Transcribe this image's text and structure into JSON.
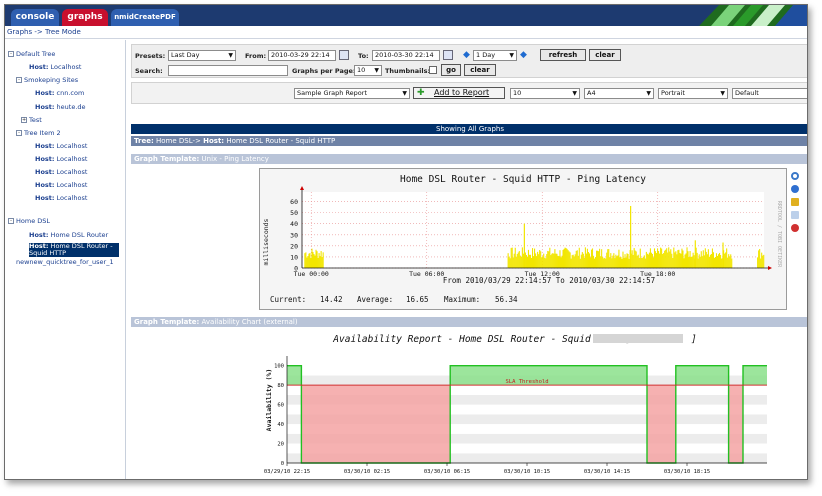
{
  "tabs": [
    {
      "label": "console",
      "color": "#2f5fb0"
    },
    {
      "label": "graphs",
      "color": "#c8102e"
    },
    {
      "label": "nmidCreatePDF",
      "color": "#2f5fb0"
    }
  ],
  "breadcrumb": "Graphs -> Tree Mode",
  "sidebar": {
    "items": [
      {
        "prefix": "",
        "label": "Default Tree",
        "box": "-"
      },
      {
        "prefix": "Host:",
        "label": " Localhost",
        "box": ""
      },
      {
        "prefix": "",
        "label": "Smokeping Sites",
        "box": "-"
      },
      {
        "prefix": "Host:",
        "label": " cnn.com",
        "box": ""
      },
      {
        "prefix": "Host:",
        "label": " heute.de",
        "box": ""
      },
      {
        "prefix": "",
        "label": "Test",
        "box": "+"
      },
      {
        "prefix": "",
        "label": "Tree Item 2",
        "box": "-"
      },
      {
        "prefix": "Host:",
        "label": " Localhost",
        "box": ""
      },
      {
        "prefix": "Host:",
        "label": " Localhost",
        "box": ""
      },
      {
        "prefix": "Host:",
        "label": " Localhost",
        "box": ""
      },
      {
        "prefix": "Host:",
        "label": " Localhost",
        "box": ""
      },
      {
        "prefix": "Host:",
        "label": " Localhost",
        "box": ""
      },
      {
        "prefix": "",
        "label": "Home DSL",
        "box": "-"
      },
      {
        "prefix": "Host:",
        "label": " Home DSL Router",
        "box": ""
      },
      {
        "prefix": "Host:",
        "label": " Home DSL Router - Squid HTTP",
        "box": ""
      },
      {
        "prefix": "",
        "label": "newnew_quicktree_for_user_1",
        "box": ""
      }
    ]
  },
  "filters": {
    "presets_label": "Presets:",
    "presets_value": "Last Day",
    "from_label": "From:",
    "from_value": "2010-03-29 22:14",
    "to_label": "To:",
    "to_value": "2010-03-30 22:14",
    "span_value": "1 Day",
    "refresh_label": "refresh",
    "clear_label": "clear",
    "search_label": "Search:",
    "search_value": "",
    "gpp_label": "Graphs per Page:",
    "gpp_value": "10",
    "thumbs_label": "Thumbnails:",
    "go_label": "go",
    "clear2_label": "clear"
  },
  "report": {
    "report_select": "Sample Graph Report",
    "add_label": "Add to Report",
    "count_select": "10",
    "paper_select": "A4",
    "orient_select": "Portrait",
    "style_select": "Default"
  },
  "showing": "Showing All Graphs",
  "tree_header": {
    "prefix": "Tree:",
    "path": " Home DSL-> ",
    "host_prefix": "Host:",
    "host": " Home DSL Router - Squid HTTP"
  },
  "template1": {
    "prefix": "Graph Template:",
    "name": " Unix - Ping Latency"
  },
  "template2": {
    "prefix": "Graph Template:",
    "name": " Availability Chart (external)"
  },
  "ping_graph": {
    "title": "Home DSL Router - Squid HTTP - Ping Latency",
    "ylabel": "milliseconds",
    "side_text": "RRDTOOL / TOBI OETIKER",
    "range_text": "From 2010/03/29 22:14:57 To 2010/03/30 22:14:57",
    "current_label": "Current:",
    "current_value": "14.42",
    "average_label": "Average:",
    "average_value": "16.65",
    "maximum_label": "Maximum:",
    "maximum_value": "56.34"
  },
  "avail_graph": {
    "title": "Availability Report - Home DSL Router - Squid HTTP [",
    "title_end": "]",
    "ylabel": "Availability (%)",
    "sla_label": "SLA Threshold"
  },
  "chart_data": [
    {
      "type": "bar",
      "title": "Home DSL Router - Squid HTTP - Ping Latency",
      "ylabel": "milliseconds",
      "x_ticks": [
        "Tue 00:00",
        "Tue 06:00",
        "Tue 12:00",
        "Tue 18:00"
      ],
      "y_ticks": [
        0,
        10,
        20,
        30,
        40,
        50,
        60
      ],
      "ylim": [
        0,
        65
      ],
      "color": "#f2e600",
      "spikes": [
        {
          "pos": 0.48,
          "value": 40
        },
        {
          "pos": 0.71,
          "value": 56
        },
        {
          "pos": 0.85,
          "value": 25
        },
        {
          "pos": 0.91,
          "value": 23
        }
      ],
      "segments": [
        {
          "start": 0.005,
          "end": 0.045,
          "base": 15
        },
        {
          "start": 0.445,
          "end": 0.93,
          "base": 15
        },
        {
          "start": 0.985,
          "end": 1.0,
          "base": 15
        }
      ],
      "current": 14.42,
      "average": 16.65,
      "maximum": 56.34
    },
    {
      "type": "area",
      "title": "Availability Report - Home DSL Router - Squid HTTP",
      "ylabel": "Availability (%)",
      "x_ticks": [
        "03/29/10 22:15",
        "03/30/10 02:15",
        "03/30/10 06:15",
        "03/30/10 10:15",
        "03/30/10 14:15",
        "03/30/10 18:15"
      ],
      "y_ticks": [
        0,
        20,
        40,
        60,
        80,
        100
      ],
      "ylim": [
        0,
        110
      ],
      "sla": 80,
      "up_color": "#8be08b",
      "down_color": "#f4a3a3",
      "sla_color": "#d03030",
      "periods": [
        {
          "start": 0.0,
          "end": 0.03,
          "value": 100
        },
        {
          "start": 0.03,
          "end": 0.34,
          "value": 0
        },
        {
          "start": 0.34,
          "end": 0.75,
          "value": 100
        },
        {
          "start": 0.75,
          "end": 0.81,
          "value": 0
        },
        {
          "start": 0.81,
          "end": 0.92,
          "value": 100
        },
        {
          "start": 0.92,
          "end": 0.95,
          "value": 0
        },
        {
          "start": 0.95,
          "end": 1.0,
          "value": 100
        }
      ]
    }
  ]
}
